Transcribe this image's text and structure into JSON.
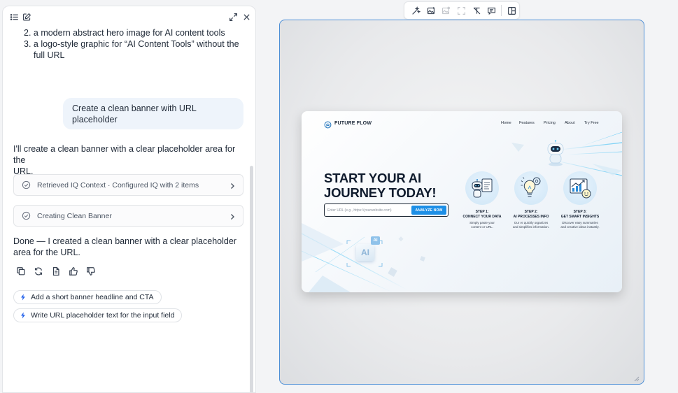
{
  "chat": {
    "list_lines": [
      "2. a modern abstract hero image for AI content tools",
      "3. a logo-style graphic for “AI Content Tools” without the",
      "full URL"
    ],
    "user_message_line1": "Create a clean banner with URL",
    "user_message_line2": "placeholder",
    "assistant_intro_line1": "I'll create a clean banner with a clear placeholder area for the",
    "assistant_intro_line2": "URL.",
    "steps": [
      {
        "label": "Retrieved IQ Context · Configured IQ with 2 items"
      },
      {
        "label": "Creating Clean Banner"
      }
    ],
    "done_line1": "Done — I created a clean banner with a clear placeholder",
    "done_line2": "area for the URL.",
    "suggestions": [
      {
        "label": "Add a short banner headline and CTA"
      },
      {
        "label": "Write URL placeholder text for the input field"
      }
    ]
  },
  "banner": {
    "brand": "FUTURE FLOW",
    "nav": [
      "Home",
      "Features",
      "Pricing",
      "About",
      "Try Free"
    ],
    "headline_line1": "START YOUR AI",
    "headline_line2": "JOURNEY TODAY!",
    "url_placeholder": "Enter URL (e.g., https://yourwebsite.com)",
    "cta": "ANALYZE NOW",
    "chip_text": "AI",
    "steps": [
      {
        "title1": "STEP 1:",
        "title2": "CONNECT YOUR DATA",
        "desc1": "Simply paste your",
        "desc2": "content or URL."
      },
      {
        "title1": "STEP 2:",
        "title2": "AI PROCESSES INFO",
        "desc1": "Our AI quickly organizes",
        "desc2": "and simplifies information."
      },
      {
        "title1": "STEP 3:",
        "title2": "GET SMART INSIGHTS",
        "desc1": "Discover easy summaries",
        "desc2": "and creative ideas instantly."
      }
    ]
  },
  "colors": {
    "accent": "#1d8fe6",
    "frame_border": "#4d8fd6",
    "user_bubble": "#eef4fb"
  }
}
